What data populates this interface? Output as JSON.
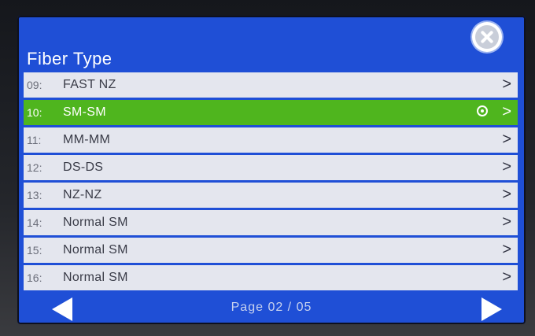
{
  "header": {
    "title": "Fiber  Type"
  },
  "rows": [
    {
      "num": "09:",
      "label": "FAST  NZ"
    },
    {
      "num": "10:",
      "label": "SM-SM"
    },
    {
      "num": "11:",
      "label": "MM-MM"
    },
    {
      "num": "12:",
      "label": "DS-DS"
    },
    {
      "num": "13:",
      "label": "NZ-NZ"
    },
    {
      "num": "14:",
      "label": "Normal  SM"
    },
    {
      "num": "15:",
      "label": "Normal  SM"
    },
    {
      "num": "16:",
      "label": "Normal  SM"
    }
  ],
  "chevron": ">",
  "selected_index": 1,
  "footer": {
    "page": "Page  02  /  05"
  },
  "colors": {
    "screen": "#1f4fd6",
    "row": "#e4e6ee",
    "selected": "#4fb51e"
  }
}
